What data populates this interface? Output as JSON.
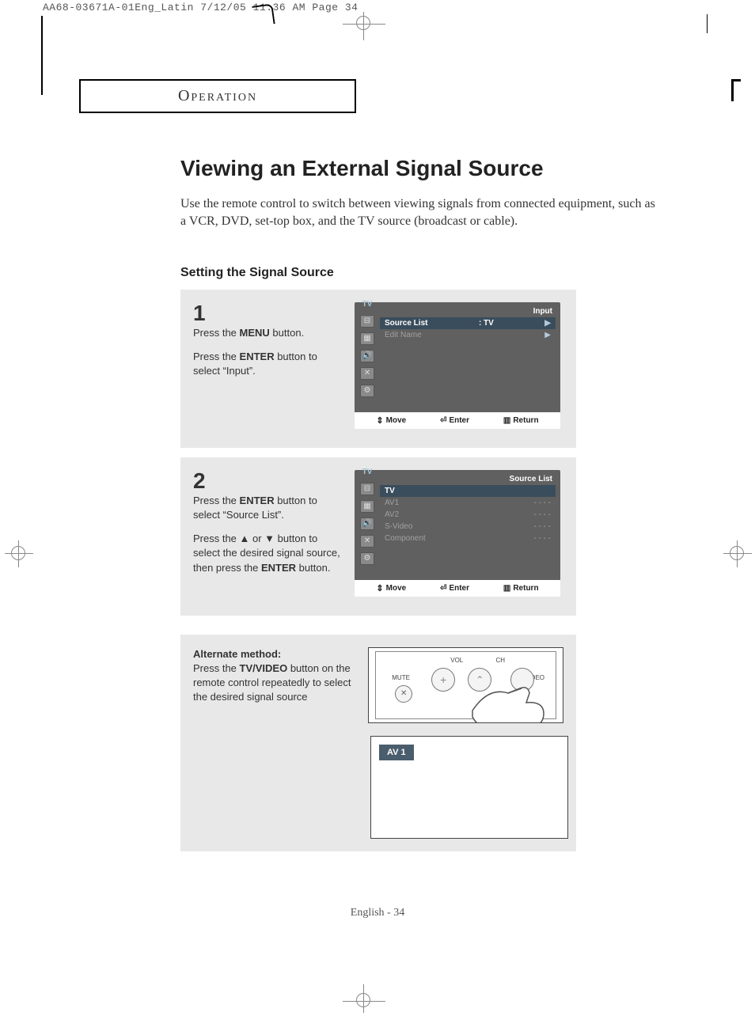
{
  "print": {
    "header": "AA68-03671A-01Eng_Latin  7/12/05  11:36 AM  Page 34"
  },
  "section_tab": "Operation",
  "title": "Viewing an External Signal Source",
  "intro": "Use the remote control to switch between viewing signals from connected equipment, such as a VCR, DVD, set-top box, and the TV source (broadcast or cable).",
  "subhead": "Setting the Signal Source",
  "steps": [
    {
      "num": "1",
      "lines": [
        "Press the <b>MENU</b> button.",
        "Press the <b>ENTER</b> button to select “Input”."
      ],
      "osd": {
        "tv_label": "TV",
        "header": "Input",
        "rows": [
          {
            "label": "Source List",
            "value": ": TV",
            "sel": true,
            "arrow": "▶"
          },
          {
            "label": "Edit Name",
            "value": "",
            "sel": false,
            "arrow": "▶",
            "dim": true
          }
        ],
        "footer": {
          "move": "Move",
          "enter": "Enter",
          "return": "Return"
        }
      }
    },
    {
      "num": "2",
      "lines": [
        "Press the <b>ENTER</b> button to select “Source List”.",
        "Press the ▲ or ▼ button to select the desired signal source, then press the <b>ENTER</b> button."
      ],
      "osd": {
        "tv_label": "TV",
        "header": "Source List",
        "rows": [
          {
            "label": "TV",
            "value": "",
            "sel": true
          },
          {
            "label": "AV1",
            "value": "- - - -",
            "dim": true
          },
          {
            "label": "AV2",
            "value": "- - - -",
            "dim": true
          },
          {
            "label": "S-Video",
            "value": "- - - -",
            "dim": true
          },
          {
            "label": "Component",
            "value": "- - - -",
            "dim": true
          }
        ],
        "footer": {
          "move": "Move",
          "enter": "Enter",
          "return": "Return"
        }
      }
    }
  ],
  "alternate": {
    "heading": "Alternate method:",
    "body": "Press the <b>TV/VIDEO</b> button on the remote control repeatedly to select the desired signal source",
    "remote_labels": {
      "vol": "VOL",
      "ch": "CH",
      "mute": "MUTE",
      "tvvideo": "TV/VIDEO"
    },
    "indicator": "AV 1"
  },
  "footer": "English - 34"
}
